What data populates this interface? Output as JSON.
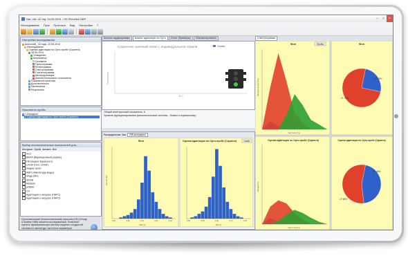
{
  "window": {
    "title": "Nat. ofic. 42 reg. 04.06.2014 - HS Pichetkin NBP",
    "controls": [
      "–",
      "□",
      "×"
    ]
  },
  "menu": [
    "Исследование",
    "Пуск",
    "Протокол",
    "Вид",
    "Настройки",
    "?"
  ],
  "research_panel": {
    "title": "Настройка исследования",
    "tree": [
      "Анатолий_ 43 года, 20.06.2014",
      "Исследование",
      "Оценка адаптации по Орто-пробе (Скрипта)",
      "18.06.2014",
      "Отведения",
      "Анализатор",
      "Основное",
      "Пульсограмма",
      "Ритмограмма",
      "Спектрограмма",
      "Статистограмма",
      "Автокорреляция",
      "Анализ Бальсового показателя",
      "Показатели качества",
      "Дополнительно",
      "Заключение",
      "Результаты"
    ]
  },
  "probe_panel": {
    "title": "Фрагменты пробы",
    "items": [
      "1 Исходное",
      "2 Оценка адаптации по Орто-пробе (Скрипта)"
    ]
  },
  "indicators_panel": {
    "title": "Выбор вспомогательных показателей для...",
    "tabs": [
      "Исходное",
      "Проба",
      "Активно",
      "Все"
    ],
    "items": [
      "ЧСС",
      "ВАРИ (Вариационный размах)",
      "ИН (индекс Баевского)",
      "LF/HF (ЧСС LF/HF)",
      "Индекс вегет.",
      "АМО (Амплитуда моды)",
      "Мода (Мо)",
      "SDNN",
      "RMSSD",
      "pNN50",
      "CV",
      "Адаптация к нагрузке (ПАРС)",
      "Адаптация к нагрузке (ПАРС)"
    ]
  },
  "description": "Ортостатический (Клиностатический) опросник (ОП) (Orvogi & Bradley 1985) является исследованием. Позволяет оценить функциональную систему сердечно-сосудистой системы по амплитуде частотных параметров. Предназначен для деятельности сердечно-сосудистой системы организма, определения уровня здоровья и функциональных возможностей.",
  "mid_tabs": [
    "Анализ кардиограммы",
    "Анализ адаптации по Орто",
    "Отчет (Примеры)",
    "Сбалансированно"
  ],
  "top_chart": {
    "title": "Сравнение значений связи с индивидуальной нормой",
    "legend": "Норма",
    "ylabel": "Показатель",
    "xlabel": "ЧСС"
  },
  "info": {
    "line1": "Общий интегральный показатель: 6",
    "line2": "Уровень функционирования физиологической системы - близко к нормальному"
  },
  "low_tabs": {
    "tab1": "Распределение",
    "tab2": "Все",
    "select": "RR-интервалы"
  },
  "hist_left": {
    "title": "Фон",
    "xlabel": "RR (с)",
    "ylabel": "Кол-во RR"
  },
  "hist_right": {
    "title": "Оценка адаптации по Орто-пробе (Скрипта)",
    "button": "Свойт",
    "xlabel": "RR (с)"
  },
  "right_tab": "Спектрограмма",
  "spectrum_top": {
    "title": "Фон",
    "button": "Пробы",
    "ylabel": "Мощность (мс²/Гц)",
    "xlabel": "Частота (Гц)"
  },
  "pie_top": {
    "title": "Фон",
    "label_hf": "HF 25%",
    "label_lf": "LF 75%"
  },
  "spectrum_bottom": {
    "title": "Оценка адаптации по Орто-пробе (Скрипта)",
    "ylabel": "Мощность",
    "xlabel": "Частота (Гц)"
  },
  "pie_bottom": {
    "title": "Оценка адаптации по Орто-пробе (Скрипта)",
    "label_hf": "HF 45%",
    "label_lf": "LF 55%"
  },
  "colors": {
    "red": "#e0412a",
    "green": "#2f9e34",
    "blue": "#2e62c9",
    "yellow": "#fdfbb4",
    "accent": "#3d7bd6"
  },
  "chart_data": [
    {
      "type": "bar",
      "title": "Фон",
      "xlabel": "RR (с)",
      "ylabel": "Кол-во RR",
      "categories": [
        "0.60",
        "0.62",
        "0.64",
        "0.66",
        "0.68",
        "0.70",
        "0.72",
        "0.74",
        "0.76",
        "0.78",
        "0.80",
        "0.82",
        "0.84",
        "0.86",
        "0.88",
        "0.90",
        "0.92",
        "0.94"
      ],
      "values": [
        0,
        0,
        1,
        2,
        3,
        5,
        8,
        16,
        30,
        52,
        40,
        22,
        14,
        8,
        4,
        2,
        1,
        0
      ],
      "ylim": [
        0,
        60
      ]
    },
    {
      "type": "bar",
      "title": "Оценка адаптации по Орто-пробе (Скрипта)",
      "xlabel": "RR (с)",
      "categories": [
        "0.50",
        "0.52",
        "0.54",
        "0.56",
        "0.58",
        "0.60",
        "0.62",
        "0.64",
        "0.66",
        "0.68",
        "0.70",
        "0.72",
        "0.74",
        "0.76",
        "0.78",
        "0.80",
        "0.82",
        "0.84"
      ],
      "values": [
        0,
        1,
        2,
        4,
        6,
        10,
        18,
        35,
        58,
        44,
        26,
        14,
        8,
        4,
        2,
        1,
        0,
        0
      ],
      "ylim": [
        0,
        60
      ]
    },
    {
      "type": "area",
      "title": "Фон",
      "x": [
        0,
        0.05,
        0.1,
        0.15,
        0.2,
        0.25,
        0.3,
        0.35,
        0.4
      ],
      "series": [
        {
          "name": "VLF",
          "values": [
            0,
            10,
            4,
            0,
            0,
            0,
            0,
            0,
            0
          ]
        },
        {
          "name": "LF",
          "values": [
            0,
            52,
            95,
            60,
            20,
            8,
            0,
            0,
            0
          ]
        },
        {
          "name": "HF",
          "values": [
            0,
            0,
            0,
            18,
            44,
            30,
            12,
            6,
            0
          ]
        }
      ]
    },
    {
      "type": "pie",
      "title": "Фон",
      "categories": [
        "HF",
        "LF"
      ],
      "values": [
        25,
        75
      ]
    },
    {
      "type": "area",
      "title": "Оценка адаптации по Орто-пробе (Скрипта)",
      "x": [
        0,
        0.05,
        0.1,
        0.15,
        0.2,
        0.25,
        0.3,
        0.35,
        0.4
      ],
      "series": [
        {
          "name": "VLF",
          "values": [
            0,
            8,
            3,
            0,
            0,
            0,
            0,
            0,
            0
          ]
        },
        {
          "name": "LF",
          "values": [
            0,
            22,
            30,
            26,
            14,
            6,
            0,
            0,
            0
          ]
        },
        {
          "name": "HF",
          "values": [
            0,
            0,
            4,
            12,
            18,
            14,
            8,
            3,
            0
          ]
        }
      ]
    },
    {
      "type": "pie",
      "title": "Оценка адаптации по Орто-пробе (Скрипта)",
      "categories": [
        "HF",
        "LF"
      ],
      "values": [
        45,
        55
      ]
    }
  ]
}
